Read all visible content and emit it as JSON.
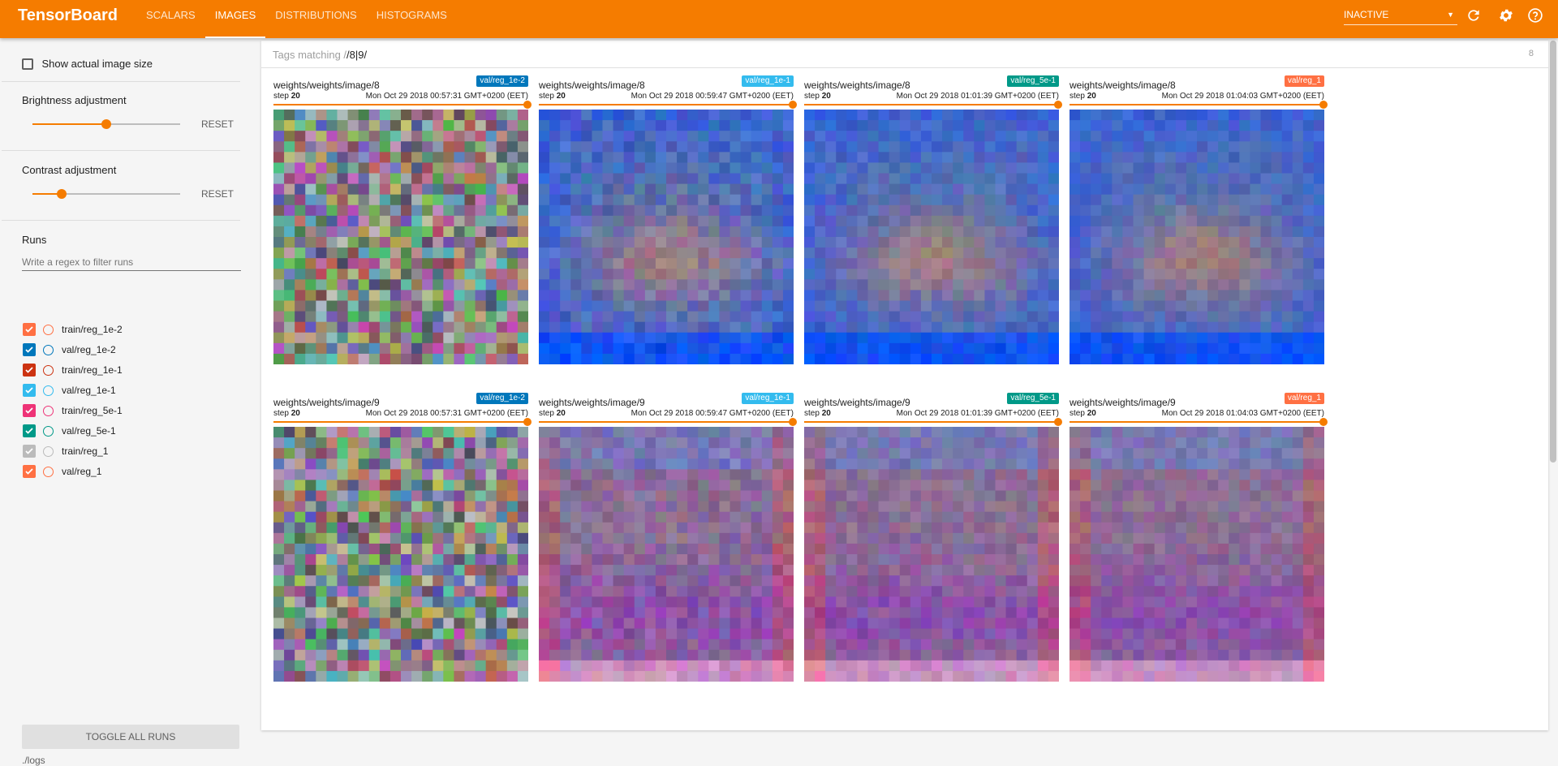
{
  "app": {
    "title": "TensorBoard"
  },
  "nav": {
    "tabs": [
      {
        "label": "SCALARS",
        "active": false
      },
      {
        "label": "IMAGES",
        "active": true
      },
      {
        "label": "DISTRIBUTIONS",
        "active": false
      },
      {
        "label": "HISTOGRAMS",
        "active": false
      }
    ],
    "status": "INACTIVE",
    "icons": [
      "refresh-icon",
      "settings-icon",
      "help-icon"
    ]
  },
  "sidebar": {
    "show_actual_size": {
      "label": "Show actual image size",
      "checked": false
    },
    "brightness": {
      "label": "Brightness adjustment",
      "value": 0.5,
      "reset": "RESET"
    },
    "contrast": {
      "label": "Contrast adjustment",
      "value": 0.2,
      "reset": "RESET"
    },
    "runs": {
      "title": "Runs",
      "filter_placeholder": "Write a regex to filter runs",
      "items": [
        {
          "label": "train/reg_1e-2",
          "color": "#ff7043",
          "checked": true
        },
        {
          "label": "val/reg_1e-2",
          "color": "#0077bb",
          "checked": true
        },
        {
          "label": "train/reg_1e-1",
          "color": "#cc3311",
          "checked": true
        },
        {
          "label": "val/reg_1e-1",
          "color": "#33bbee",
          "checked": true
        },
        {
          "label": "train/reg_5e-1",
          "color": "#ee3377",
          "checked": true
        },
        {
          "label": "val/reg_5e-1",
          "color": "#009988",
          "checked": true
        },
        {
          "label": "train/reg_1",
          "color": "#bbbbbb",
          "checked": true
        },
        {
          "label": "val/reg_1",
          "color": "#ff7043",
          "checked": true
        }
      ]
    },
    "toggle_all": "TOGGLE ALL RUNS",
    "logdir": "./logs"
  },
  "main": {
    "tags_prefix": "Tags matching /",
    "tags_query": "/8|9/",
    "tag_count": "8",
    "rows": [
      {
        "tag": "weights/weights/image/8",
        "cards": [
          {
            "run": "val/reg_1e-2",
            "run_color": "#0077bb",
            "step_label": "step",
            "step": "20",
            "date": "Mon Oct 29 2018 00:57:31 GMT+0200 (EET)"
          },
          {
            "run": "val/reg_1e-1",
            "run_color": "#33bbee",
            "step_label": "step",
            "step": "20",
            "date": "Mon Oct 29 2018 00:59:47 GMT+0200 (EET)"
          },
          {
            "run": "val/reg_5e-1",
            "run_color": "#009988",
            "step_label": "step",
            "step": "20",
            "date": "Mon Oct 29 2018 01:01:39 GMT+0200 (EET)"
          },
          {
            "run": "val/reg_1",
            "run_color": "#ff7043",
            "step_label": "step",
            "step": "20",
            "date": "Mon Oct 29 2018 01:04:03 GMT+0200 (EET)"
          }
        ]
      },
      {
        "tag": "weights/weights/image/9",
        "cards": [
          {
            "run": "val/reg_1e-2",
            "run_color": "#0077bb",
            "step_label": "step",
            "step": "20",
            "date": "Mon Oct 29 2018 00:57:31 GMT+0200 (EET)"
          },
          {
            "run": "val/reg_1e-1",
            "run_color": "#33bbee",
            "step_label": "step",
            "step": "20",
            "date": "Mon Oct 29 2018 00:59:47 GMT+0200 (EET)"
          },
          {
            "run": "val/reg_5e-1",
            "run_color": "#009988",
            "step_label": "step",
            "step": "20",
            "date": "Mon Oct 29 2018 01:01:39 GMT+0200 (EET)"
          },
          {
            "run": "val/reg_1",
            "run_color": "#ff7043",
            "step_label": "step",
            "step": "20",
            "date": "Mon Oct 29 2018 01:04:03 GMT+0200 (EET)"
          }
        ]
      }
    ]
  }
}
